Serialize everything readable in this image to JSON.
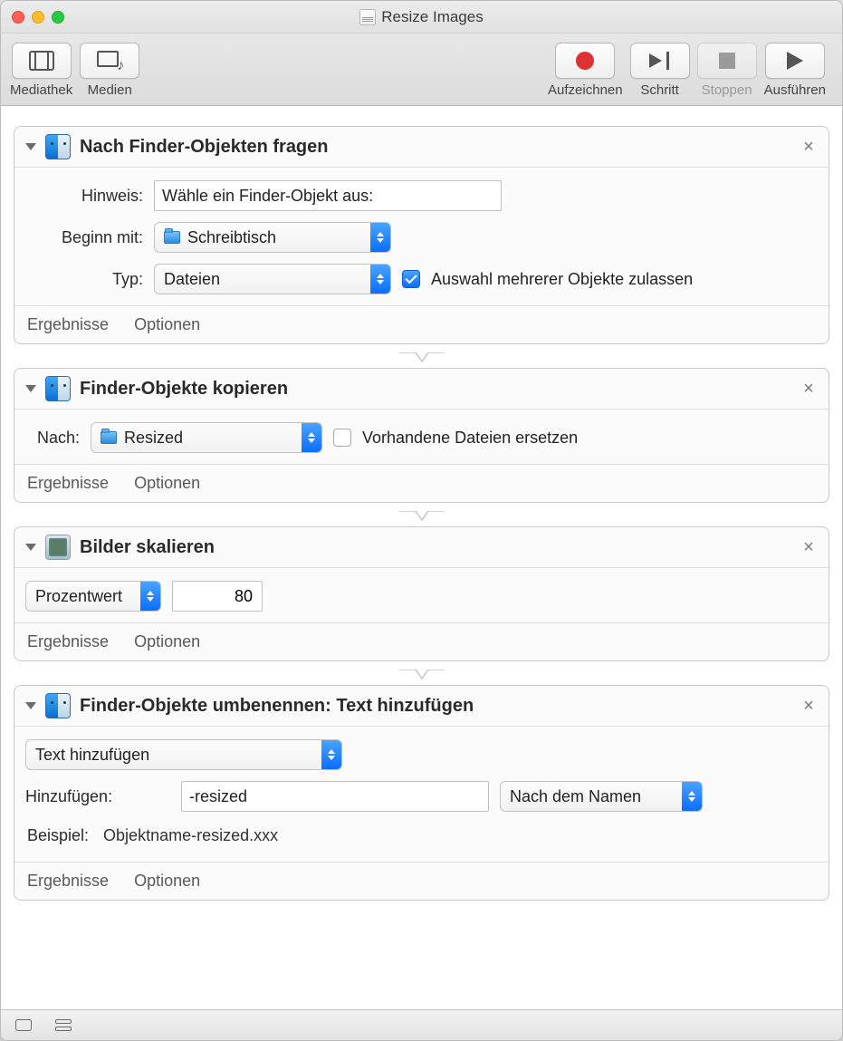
{
  "window": {
    "title": "Resize Images"
  },
  "toolbar": {
    "library": "Mediathek",
    "media": "Medien",
    "record": "Aufzeichnen",
    "step": "Schritt",
    "stop": "Stoppen",
    "run": "Ausführen"
  },
  "footer": {
    "results": "Ergebnisse",
    "options": "Optionen"
  },
  "actions": [
    {
      "title": "Nach Finder-Objekten fragen",
      "icon": "finder",
      "labels": {
        "hint": "Hinweis:",
        "start": "Beginn mit:",
        "type": "Typ:"
      },
      "hint_value": "Wähle ein Finder-Objekt aus:",
      "start_value": "Schreibtisch",
      "type_value": "Dateien",
      "multi_label": "Auswahl mehrerer Objekte zulassen",
      "multi_checked": true
    },
    {
      "title": "Finder-Objekte kopieren",
      "icon": "finder",
      "labels": {
        "to": "Nach:"
      },
      "dest_value": "Resized",
      "replace_label": "Vorhandene Dateien ersetzen",
      "replace_checked": false
    },
    {
      "title": "Bilder skalieren",
      "icon": "preview",
      "mode_value": "Prozentwert",
      "amount_value": "80"
    },
    {
      "title": "Finder-Objekte umbenennen: Text hinzufügen",
      "icon": "finder",
      "mode_value": "Text hinzufügen",
      "labels": {
        "add": "Hinzufügen:",
        "example": "Beispiel:"
      },
      "add_value": "-resized",
      "position_value": "Nach dem Namen",
      "example_value": "Objektname-resized.xxx"
    }
  ]
}
